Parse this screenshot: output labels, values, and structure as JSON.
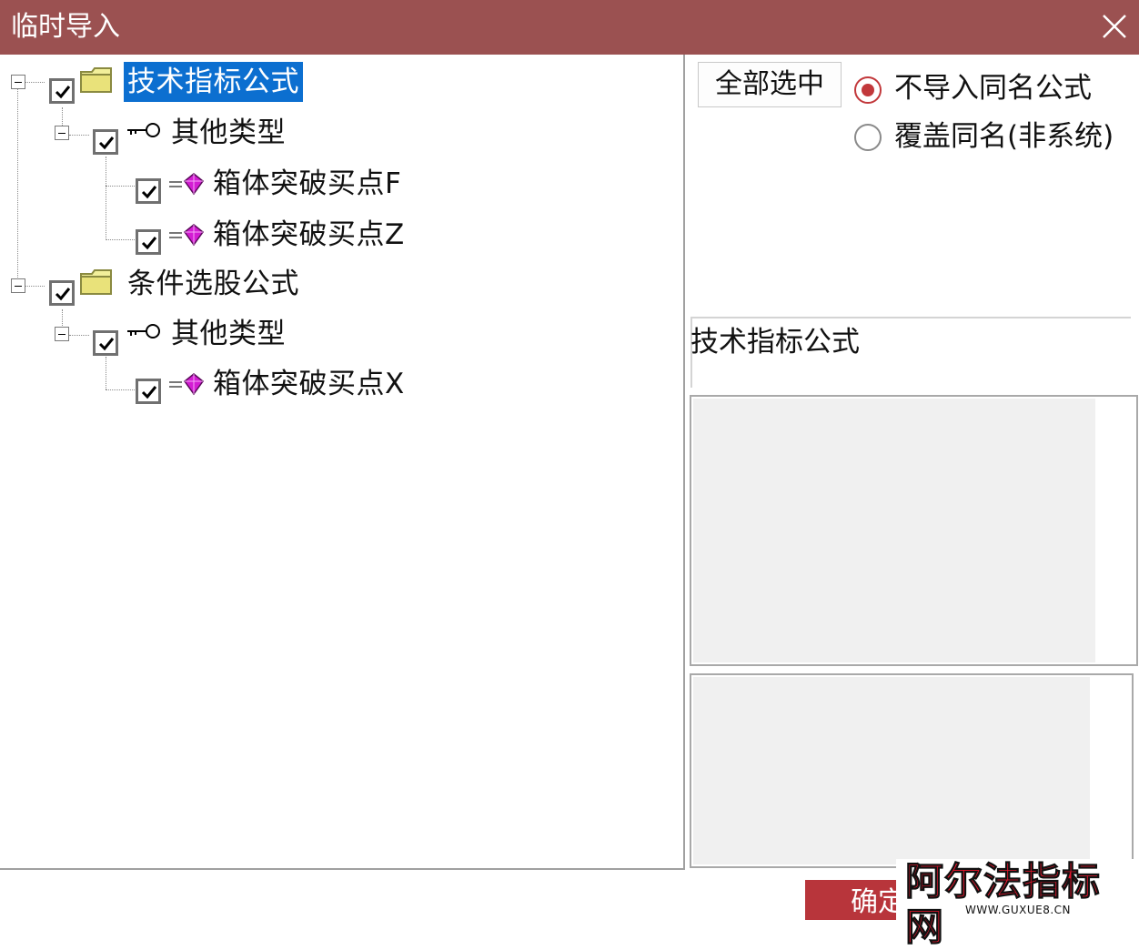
{
  "window": {
    "title": "临时导入",
    "close_icon": "close-icon"
  },
  "tree": {
    "nodes": [
      {
        "label": "技术指标公式",
        "icon": "folder-icon",
        "checked": true,
        "selected": true
      },
      {
        "label": "其他类型",
        "icon": "key-icon",
        "checked": true
      },
      {
        "label": "箱体突破买点F",
        "icon": "formula-gem-icon",
        "checked": true
      },
      {
        "label": "箱体突破买点Z",
        "icon": "formula-gem-icon",
        "checked": true
      },
      {
        "label": "条件选股公式",
        "icon": "folder-icon",
        "checked": true
      },
      {
        "label": "其他类型",
        "icon": "key-icon",
        "checked": true
      },
      {
        "label": "箱体突破买点X",
        "icon": "formula-gem-icon",
        "checked": true
      }
    ]
  },
  "options": {
    "select_all_label": "全部选中",
    "radio_no_import": "不导入同名公式",
    "radio_overwrite": "覆盖同名(非系统)",
    "selected_radio": "不导入同名公式"
  },
  "info": {
    "selected_name": "技术指标公式"
  },
  "footer": {
    "ok_label": "确定"
  },
  "watermark": {
    "title": "阿尔法指标网",
    "url": "WWW.GUXUE8.CN"
  },
  "colors": {
    "titlebar": "#9b5151",
    "selection": "#0c6fd0",
    "accent_red": "#c2383b",
    "ok_button": "#b8353b"
  }
}
